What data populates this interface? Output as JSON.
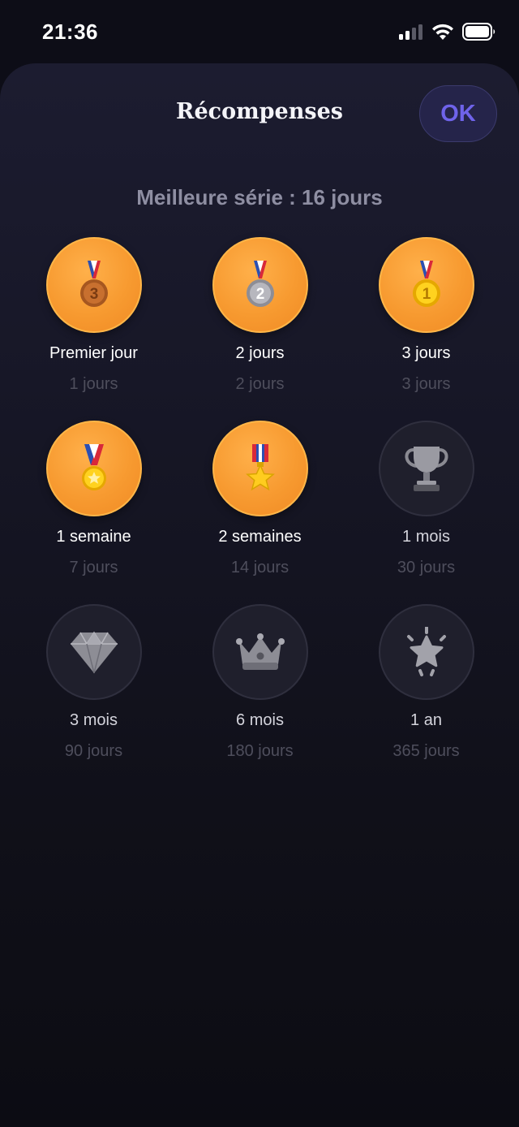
{
  "status_bar": {
    "time": "21:36",
    "icons": [
      "cellular-signal-icon",
      "wifi-icon",
      "battery-icon"
    ]
  },
  "sheet": {
    "title": "Récompenses",
    "ok_label": "OK",
    "best_streak": "Meilleure série : 16 jours"
  },
  "colors": {
    "unlocked": "#f79a30",
    "locked": "#1f1f2c",
    "accent": "#6f63ea"
  },
  "badges": [
    {
      "title": "Premier jour",
      "subtitle": "1 jours",
      "unlocked": true,
      "icon": "bronze-medal-icon"
    },
    {
      "title": "2 jours",
      "subtitle": "2 jours",
      "unlocked": true,
      "icon": "silver-medal-icon"
    },
    {
      "title": "3 jours",
      "subtitle": "3 jours",
      "unlocked": true,
      "icon": "gold-medal-icon"
    },
    {
      "title": "1 semaine",
      "subtitle": "7 jours",
      "unlocked": true,
      "icon": "sports-medal-icon"
    },
    {
      "title": "2 semaines",
      "subtitle": "14 jours",
      "unlocked": true,
      "icon": "military-medal-icon"
    },
    {
      "title": "1 mois",
      "subtitle": "30 jours",
      "unlocked": false,
      "icon": "trophy-icon"
    },
    {
      "title": "3 mois",
      "subtitle": "90 jours",
      "unlocked": false,
      "icon": "diamond-icon"
    },
    {
      "title": "6 mois",
      "subtitle": "180 jours",
      "unlocked": false,
      "icon": "crown-icon"
    },
    {
      "title": "1 an",
      "subtitle": "365 jours",
      "unlocked": false,
      "icon": "glowing-star-icon"
    }
  ]
}
